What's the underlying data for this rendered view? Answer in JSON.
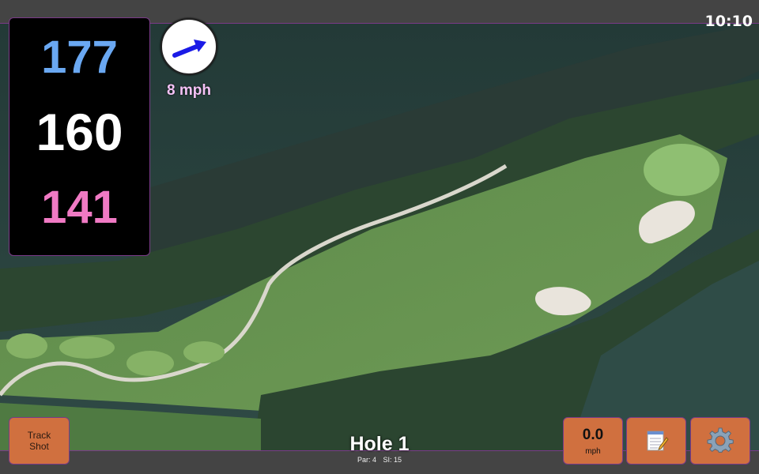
{
  "status": {
    "time": "10:10"
  },
  "distances": {
    "back": {
      "value": "177",
      "color": "#6aa8f2"
    },
    "middle": {
      "value": "160",
      "color": "#ffffff"
    },
    "front": {
      "value": "141",
      "color": "#f07ac4"
    }
  },
  "wind": {
    "speed_label": "8 mph",
    "label_color": "#f4c2f6",
    "arrow_color": "#1a1ae6"
  },
  "hole": {
    "title": "Hole 1",
    "par": "Par: 4",
    "si": "SI: 15"
  },
  "buttons": {
    "track_shot_line1": "Track",
    "track_shot_line2": "Shot",
    "speed_value": "0.0",
    "speed_unit": "mph",
    "notes_icon": "notepad-icon",
    "settings_icon": "gear-icon"
  },
  "colors": {
    "button_bg": "#d0703f",
    "border_accent": "#7a3a88"
  }
}
